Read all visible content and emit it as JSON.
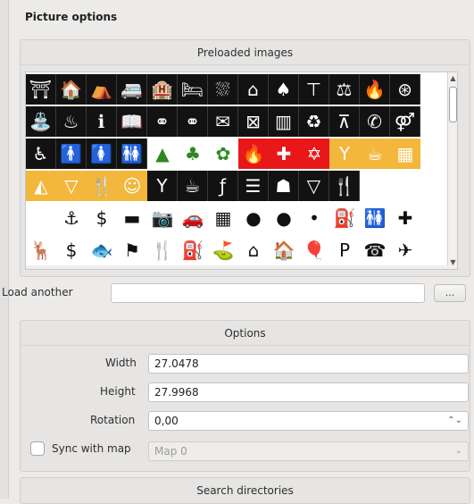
{
  "panel_title": "Picture options",
  "preloaded": {
    "title": "Preloaded images",
    "rows": [
      {
        "style": "black",
        "icons": [
          "⛩",
          "🏠",
          "⛺",
          "🚐",
          "🏨",
          "🛏",
          "⛆",
          "⌂",
          "♠",
          "⊤",
          "⚖",
          "🔥",
          "⊛"
        ]
      },
      {
        "style": "black",
        "icons": [
          "⛲",
          "♨",
          "ℹ",
          "📖",
          "⚭",
          "⚭",
          "✉",
          "⊠",
          "▥",
          "♻",
          "⊼",
          "✆",
          "⚤"
        ]
      },
      {
        "style": "mixed",
        "icons": [
          {
            "c": "black",
            "g": "♿"
          },
          {
            "c": "black",
            "g": "🚹"
          },
          {
            "c": "black",
            "g": "🚺"
          },
          {
            "c": "black",
            "g": "🚻"
          },
          {
            "c": "green",
            "g": "▲"
          },
          {
            "c": "green",
            "g": "♣"
          },
          {
            "c": "green",
            "g": "✿"
          },
          {
            "c": "red",
            "g": "🔥"
          },
          {
            "c": "red",
            "g": "✚"
          },
          {
            "c": "red",
            "g": "✡"
          },
          {
            "c": "orange",
            "g": "Y"
          },
          {
            "c": "orange",
            "g": "☕"
          },
          {
            "c": "orange",
            "g": "▦"
          }
        ]
      },
      {
        "style": "mixed",
        "icons": [
          {
            "c": "orange",
            "g": "◭"
          },
          {
            "c": "orange",
            "g": "▽"
          },
          {
            "c": "orange",
            "g": "🍴"
          },
          {
            "c": "orange",
            "g": "☺"
          },
          {
            "c": "black",
            "g": "Y"
          },
          {
            "c": "black",
            "g": "☕"
          },
          {
            "c": "black",
            "g": "ƒ"
          },
          {
            "c": "black",
            "g": "☰"
          },
          {
            "c": "black",
            "g": "☗"
          },
          {
            "c": "black",
            "g": "▽"
          },
          {
            "c": "black",
            "g": "🍴"
          }
        ]
      },
      {
        "style": "white",
        "icons": [
          "",
          "⚓",
          "$",
          "▬",
          "📷",
          "🚗",
          "▦",
          "●",
          "●",
          "•",
          "⛽",
          "🚻",
          "✚"
        ]
      },
      {
        "style": "white",
        "icons": [
          "🦌",
          "$",
          "🐟",
          "⚑",
          "🍴",
          "⛽",
          "⛳",
          "⌂",
          "🏠",
          "🎈",
          "P",
          "☎",
          "✈"
        ]
      }
    ]
  },
  "load_another": {
    "label": "Load another",
    "value": "",
    "browse_label": "..."
  },
  "options": {
    "title": "Options",
    "width_label": "Width",
    "width_value": "27.0478",
    "height_label": "Height",
    "height_value": "27.9968",
    "rotation_label": "Rotation",
    "rotation_value": "0,00",
    "sync_label": "Sync with map",
    "map_value": "Map 0"
  },
  "search": {
    "title": "Search directories"
  }
}
